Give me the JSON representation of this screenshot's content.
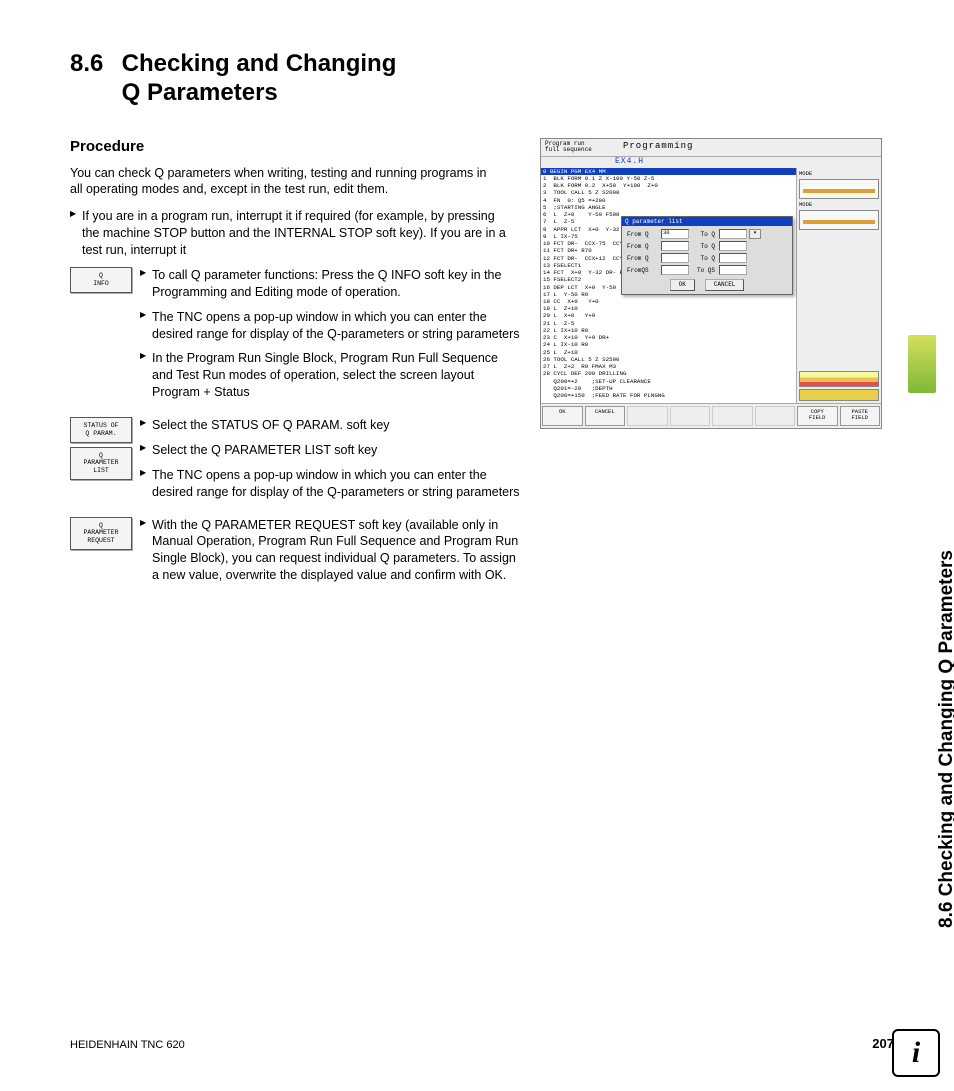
{
  "heading_num": "8.6",
  "heading_title": "Checking and Changing\nQ Parameters",
  "side_tab": "8.6 Checking and Changing Q Parameters",
  "subheading": "Procedure",
  "intro": "You can check Q parameters when writing, testing and running programs in all operating modes and, except in the test run, edit them.",
  "bullet_top": "If you are in a program run, interrupt it if required (for example, by pressing the machine STOP button and the INTERNAL STOP soft key). If you are in a test run, interrupt it",
  "softkeys": {
    "q_info": "Q\nINFO",
    "status_q": "STATUS OF\nQ PARAM.",
    "q_list": "Q\nPARAMETER\nLIST",
    "q_request": "Q\nPARAMETER\nREQUEST"
  },
  "steps": {
    "s1": "To call Q parameter functions: Press the Q INFO soft key in the Programming and Editing mode of operation.",
    "s2": "The TNC opens a pop-up window in which you can enter the desired range for display of the Q-parameters or string parameters",
    "s3": "In the Program Run Single Block, Program Run Full Sequence and Test Run modes of operation, select the screen layout Program + Status",
    "s4": "Select the STATUS OF Q PARAM. soft key",
    "s5": "Select the Q PARAMETER LIST soft key",
    "s6": "The TNC opens a pop-up window in which you can enter the desired range for display of the Q-parameters or string parameters",
    "s7": "With the Q PARAMETER REQUEST soft key (available only in Manual Operation, Program Run Full Sequence and Program Run Single Block), you can request individual Q parameters. To assign a new value, overwrite the displayed value and confirm with OK."
  },
  "screen": {
    "mode_left": "Program run\nfull sequence",
    "mode_right": "Programming",
    "filename": "EX4.H",
    "highlight": "0  BEGIN PGM EX4 MM",
    "code": [
      "1  BLK FORM 0.1 Z X-100 Y-50 Z-5",
      "2  BLK FORM 0.2  X+50  Y+100  Z+0",
      "3  TOOL CALL 5 Z S2000",
      "4  FN  0: Q5 =+200",
      "5  ;STARTING ANGLE",
      "6  L  Z+0    Y-50 F500",
      "7  L  Z-5",
      "8  APPR LCT  X+0  Y-32",
      "9  L IX-75",
      "10 FCT DR-  CCX-75  CCY",
      "11 FCT DR+ R70",
      "12 FCT DR-  CCX+12  CCY",
      "13 FSELECT1",
      "14 FCT  X+0  Y-32 DR- R",
      "15 FSELECT2",
      "16 DEP LCT  X+0  Y-50",
      "17 L  Y-50 R0",
      "18 CC  X+0   Y+0",
      "19 L  Z+10",
      "20 L  X+0   Y+0",
      "21 L  Z-5",
      "22 L IX+10 R0",
      "23 C  X+10  Y+0 DR+",
      "24 L IX-10 R0",
      "25 L  Z+10",
      "26 TOOL CALL 5 Z S2500",
      "27 L  Z+2  R0 FMAX M3",
      "28 CYCL DEF 200 DRILLING",
      "   Q200=+2    ;SET-UP CLEARANCE",
      "   Q201=-20   ;DEPTH",
      "   Q206=+150  ;FEED RATE FOR PLNGNG"
    ],
    "popup": {
      "title": "Q parameter list",
      "rows": [
        {
          "l1": "From Q",
          "v1": "30",
          "l2": "To Q",
          "v2": "",
          "ddl": true
        },
        {
          "l1": "From Q",
          "v1": "",
          "l2": "To Q",
          "v2": "",
          "ddl": false
        },
        {
          "l1": "From Q",
          "v1": "",
          "l2": "To Q",
          "v2": "",
          "ddl": false
        },
        {
          "l1": "FromQS",
          "v1": "",
          "l2": "To QS",
          "v2": "",
          "ddl": false
        }
      ],
      "ok": "OK",
      "cancel": "CANCEL"
    },
    "right_labels": {
      "mode": "MODE"
    },
    "bottom_sk": {
      "ok": "OK",
      "cancel": "CANCEL",
      "copy": "COPY\nFIELD",
      "paste": "PASTE\nFIELD"
    }
  },
  "footer_left": "HEIDENHAIN TNC 620",
  "footer_page": "207",
  "info_icon": "i"
}
